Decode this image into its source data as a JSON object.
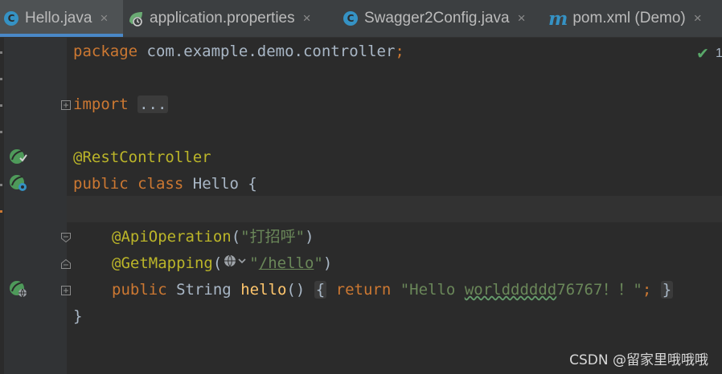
{
  "tabs": [
    {
      "label": "Hello.java",
      "icon": "java-class-icon",
      "active": true
    },
    {
      "label": "application.properties",
      "icon": "spring-config-icon",
      "active": false
    },
    {
      "label": "Swagger2Config.java",
      "icon": "java-class-icon",
      "active": false
    },
    {
      "label": "pom.xml (Demo)",
      "icon": "maven-icon",
      "active": false
    }
  ],
  "close_glyph": "×",
  "class_icon_letter": "C",
  "maven_icon_letter": "m",
  "code": {
    "package_kw": "package",
    "package_name": "com.example.demo.controller",
    "semicolon": ";",
    "import_kw": "import",
    "import_fold": "...",
    "rest_controller": "@RestController",
    "public_kw": "public",
    "class_kw": "class",
    "class_name": "Hello",
    "open_brace": "{",
    "api_operation": "@ApiOperation",
    "api_open": "(",
    "api_value": "\"打招呼\"",
    "api_close": ")",
    "get_mapping": "@GetMapping",
    "mapping_open": "(",
    "mapping_quote_open": "\"",
    "mapping_path": "/hello",
    "mapping_quote_close": "\"",
    "mapping_close": ")",
    "string_type": "String",
    "method_name": "hello",
    "parens": "()",
    "return_kw": "return",
    "return_quote": "\"Hello ",
    "return_typo": "worldddddd",
    "return_tail": "76767！！\"",
    "close_brace": "}"
  },
  "inspection": {
    "count": "1"
  },
  "watermark": "CSDN @留家里哦哦哦",
  "colors": {
    "background": "#2b2b2b",
    "keyword": "#cc7832",
    "annotation": "#bbb529",
    "string": "#6a8759",
    "function": "#ffc66d",
    "text": "#a9b7c6",
    "active_tab_accent": "#4a88c7"
  }
}
